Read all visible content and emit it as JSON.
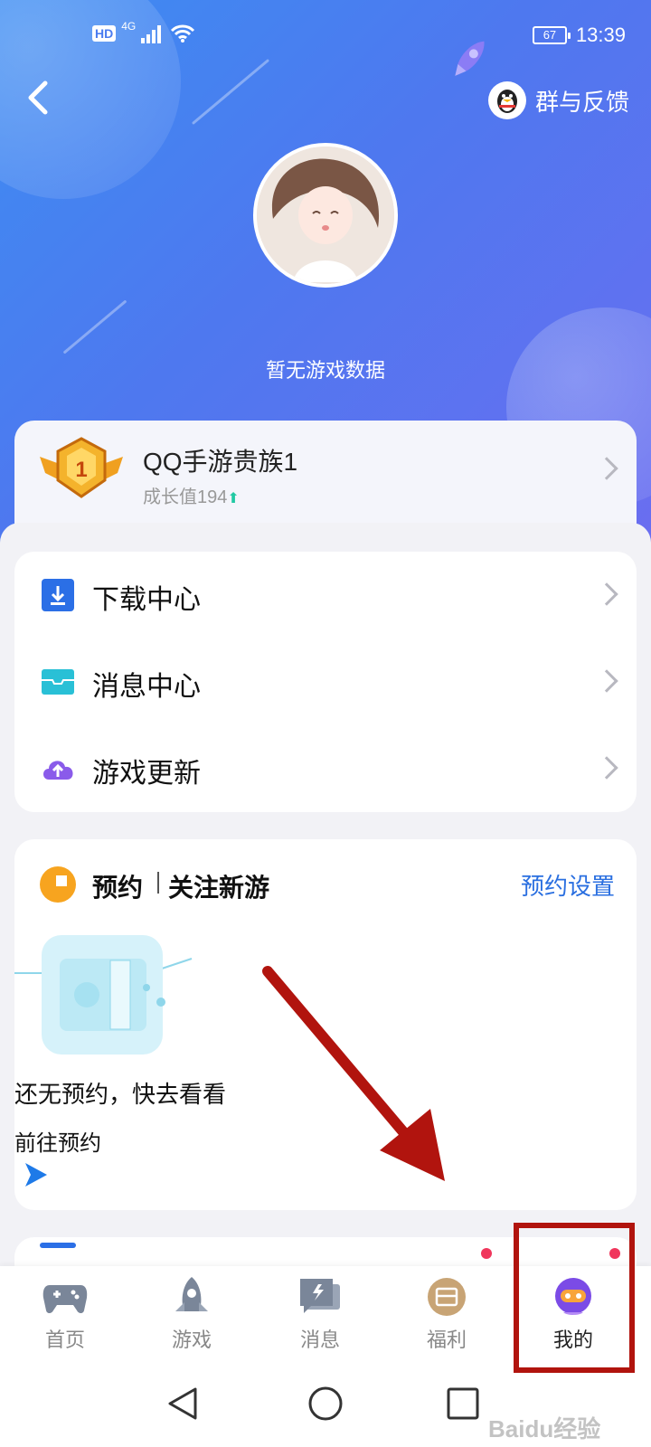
{
  "status_bar": {
    "network": "HD",
    "signal_label": "4G",
    "battery": "67",
    "time": "13:39"
  },
  "header": {
    "feedback_label": "群与反馈"
  },
  "profile": {
    "no_data_text": "暂无游戏数据"
  },
  "vip": {
    "level": "1",
    "title": "QQ手游贵族1",
    "growth_label": "成长值194",
    "growth_arrow": "⬆"
  },
  "menu": {
    "items": [
      {
        "label": "下载中心",
        "icon": "download-icon",
        "color": "#2b6fe6"
      },
      {
        "label": "消息中心",
        "icon": "message-icon",
        "color": "#29c0d6"
      },
      {
        "label": "游戏更新",
        "icon": "update-icon",
        "color": "#8a5bea"
      }
    ]
  },
  "reserve": {
    "title": "预约",
    "title2": "关注新游",
    "settings_label": "预约设置",
    "empty_text": "还无预约，快去看看",
    "goto_label": "前往预约"
  },
  "tabs": [
    {
      "label": "首页",
      "icon": "gamepad-icon"
    },
    {
      "label": "游戏",
      "icon": "rocket-icon"
    },
    {
      "label": "消息",
      "icon": "message-icon"
    },
    {
      "label": "福利",
      "icon": "gift-icon",
      "badge": true
    },
    {
      "label": "我的",
      "icon": "mascot-icon",
      "badge": true,
      "active": true
    }
  ],
  "watermark": "Baidu经验",
  "colors": {
    "accent": "#2a6fe0",
    "hero_start": "#3d8df2",
    "hero_end": "#6a6ef0",
    "highlight": "#b1140e"
  }
}
